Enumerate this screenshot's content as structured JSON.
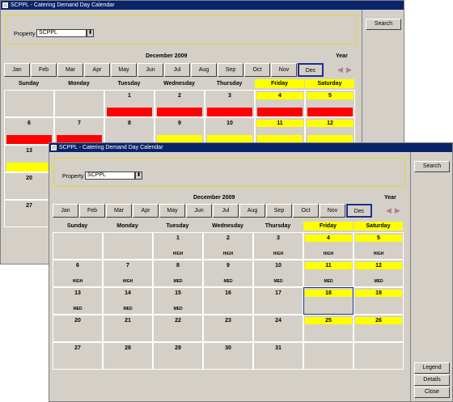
{
  "back": {
    "title": "SCPPL - Catering Demand Day Calendar",
    "property_label": "Property",
    "property_value": "SCPPL",
    "dropdown_glyph": "⬍",
    "search_label": "Search",
    "month_title": "December 2009",
    "year_label": "Year",
    "months": [
      "Jan",
      "Feb",
      "Mar",
      "Apr",
      "May",
      "Jun",
      "Jul",
      "Aug",
      "Sep",
      "Oct",
      "Nov",
      "Dec"
    ],
    "selected_month": "Dec",
    "weekdays": [
      "Sunday",
      "Monday",
      "Tuesday",
      "Wednesday",
      "Thursday",
      "Friday",
      "Saturday"
    ],
    "rows": [
      [
        {
          "d": ""
        },
        {
          "d": ""
        },
        {
          "d": "1",
          "bar": "red"
        },
        {
          "d": "2",
          "bar": "red"
        },
        {
          "d": "3",
          "bar": "red"
        },
        {
          "d": "4",
          "bar": "red"
        },
        {
          "d": "5",
          "bar": "red"
        }
      ],
      [
        {
          "d": "6",
          "bar": "red"
        },
        {
          "d": "7",
          "bar": "red"
        },
        {
          "d": "8"
        },
        {
          "d": "9",
          "bar": "yel"
        },
        {
          "d": "10",
          "bar": "yel"
        },
        {
          "d": "11",
          "bar": "yel"
        },
        {
          "d": "12",
          "bar": "yel"
        }
      ],
      [
        {
          "d": "13",
          "bar": "yel"
        },
        {
          "d": ""
        },
        {
          "d": ""
        },
        {
          "d": ""
        },
        {
          "d": ""
        },
        {
          "d": ""
        },
        {
          "d": ""
        }
      ],
      [
        {
          "d": "20"
        },
        {
          "d": ""
        },
        {
          "d": ""
        },
        {
          "d": ""
        },
        {
          "d": ""
        },
        {
          "d": ""
        },
        {
          "d": ""
        }
      ],
      [
        {
          "d": "27"
        },
        {
          "d": ""
        },
        {
          "d": ""
        },
        {
          "d": ""
        },
        {
          "d": ""
        },
        {
          "d": ""
        },
        {
          "d": ""
        }
      ]
    ]
  },
  "front": {
    "title": "SCPPL - Catering Demand Day Calendar",
    "property_label": "Property",
    "property_value": "SCPPL",
    "dropdown_glyph": "⬍",
    "search_label": "Search",
    "legend_label": "Legend",
    "details_label": "Details",
    "close_label": "Close",
    "month_title": "December 2009",
    "year_label": "Year",
    "months": [
      "Jan",
      "Feb",
      "Mar",
      "Apr",
      "May",
      "Jun",
      "Jul",
      "Aug",
      "Sep",
      "Oct",
      "Nov",
      "Dec"
    ],
    "selected_month": "Dec",
    "weekdays": [
      "Sunday",
      "Monday",
      "Tuesday",
      "Wednesday",
      "Thursday",
      "Friday",
      "Saturday"
    ],
    "rows": [
      [
        {
          "d": ""
        },
        {
          "d": ""
        },
        {
          "d": "1",
          "lvl": "HIGH"
        },
        {
          "d": "2",
          "lvl": "HIGH"
        },
        {
          "d": "3",
          "lvl": "HIGH"
        },
        {
          "d": "4",
          "lvl": "HIGH"
        },
        {
          "d": "5",
          "lvl": "HIGH"
        }
      ],
      [
        {
          "d": "6",
          "lvl": "HIGH"
        },
        {
          "d": "7",
          "lvl": "HIGH"
        },
        {
          "d": "8",
          "lvl": "MED"
        },
        {
          "d": "9",
          "lvl": "MED"
        },
        {
          "d": "10",
          "lvl": "MED"
        },
        {
          "d": "11",
          "lvl": "MED"
        },
        {
          "d": "12",
          "lvl": "MED"
        }
      ],
      [
        {
          "d": "13",
          "lvl": "MED"
        },
        {
          "d": "14",
          "lvl": "MED"
        },
        {
          "d": "15",
          "lvl": "MED"
        },
        {
          "d": "16"
        },
        {
          "d": "17"
        },
        {
          "d": "18",
          "today": true
        },
        {
          "d": "19"
        }
      ],
      [
        {
          "d": "20"
        },
        {
          "d": "21"
        },
        {
          "d": "22"
        },
        {
          "d": "23"
        },
        {
          "d": "24"
        },
        {
          "d": "25"
        },
        {
          "d": "26"
        }
      ],
      [
        {
          "d": "27"
        },
        {
          "d": "28"
        },
        {
          "d": "29"
        },
        {
          "d": "30"
        },
        {
          "d": "31"
        },
        {
          "d": ""
        },
        {
          "d": ""
        }
      ]
    ]
  },
  "colors": {
    "high": "#ff0000",
    "med": "#ffff00",
    "weekend": "#ffff00",
    "selection": "#1c2f8c"
  }
}
